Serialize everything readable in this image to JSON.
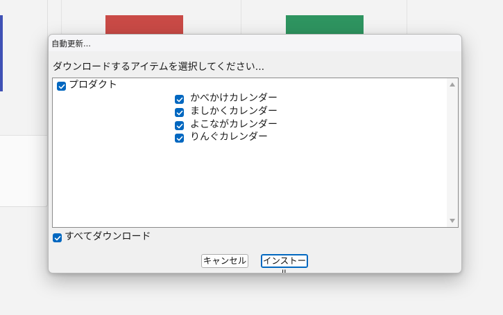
{
  "colors": {
    "accent": "#0067c0",
    "swatch_red": "#c94a46",
    "swatch_green": "#2e9460",
    "sidebar_accent": "#3f51b5"
  },
  "dialog": {
    "title": "自動更新...",
    "prompt": "ダウンロードするアイテムを選択してください...",
    "tree": {
      "root": {
        "label": "プロダクト",
        "checked": true
      },
      "children": [
        {
          "label": "かべかけカレンダー",
          "checked": true
        },
        {
          "label": "ましかくカレンダー",
          "checked": true
        },
        {
          "label": "よこながカレンダー",
          "checked": true
        },
        {
          "label": "りんぐカレンダー",
          "checked": true
        }
      ]
    },
    "download_all": {
      "label": "すべてダウンロード",
      "checked": true
    },
    "buttons": {
      "cancel": "キャンセル",
      "install": "インストール"
    }
  }
}
